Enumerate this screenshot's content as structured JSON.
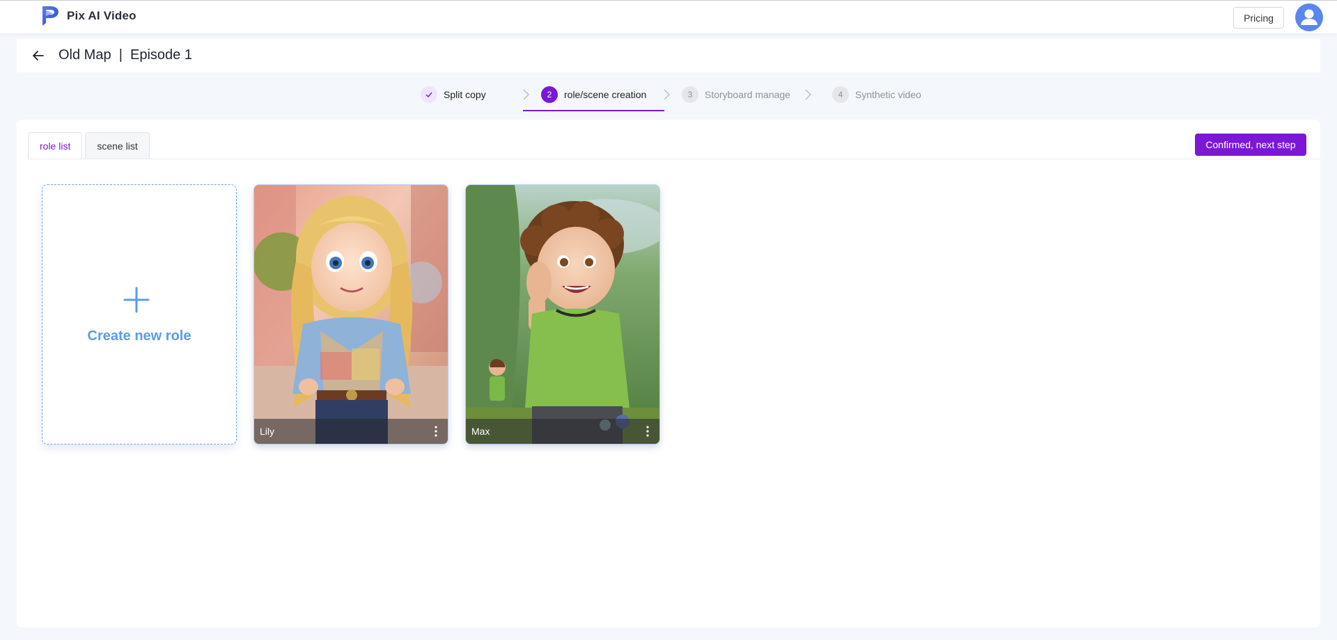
{
  "header": {
    "brand_name": "Pix AI Video",
    "logo_icon": "p-logo-icon",
    "pricing_label": "Pricing",
    "avatar_icon": "user-icon"
  },
  "titlebar": {
    "back_icon": "arrow-left-icon",
    "title": "Old Map  |  Episode 1"
  },
  "steps": [
    {
      "number": "✓",
      "label": "Split copy",
      "state": "done"
    },
    {
      "number": "2",
      "label": "role/scene creation",
      "state": "active"
    },
    {
      "number": "3",
      "label": "Storyboard manage",
      "state": "pending"
    },
    {
      "number": "4",
      "label": "Synthetic video",
      "state": "pending"
    }
  ],
  "tabs": [
    {
      "label": "role list",
      "active": true
    },
    {
      "label": "scene list",
      "active": false
    }
  ],
  "actions": {
    "next_label": "Confirmed, next step"
  },
  "create_card": {
    "label": "Create new role",
    "icon": "plus-icon"
  },
  "roles": [
    {
      "name": "Lily",
      "menu_icon": "more-vertical-icon"
    },
    {
      "name": "Max",
      "menu_icon": "more-vertical-icon"
    }
  ],
  "colors": {
    "accent": "#7b18d6",
    "create_blue": "#5b9be8",
    "page_bg": "#f4f7fc"
  }
}
